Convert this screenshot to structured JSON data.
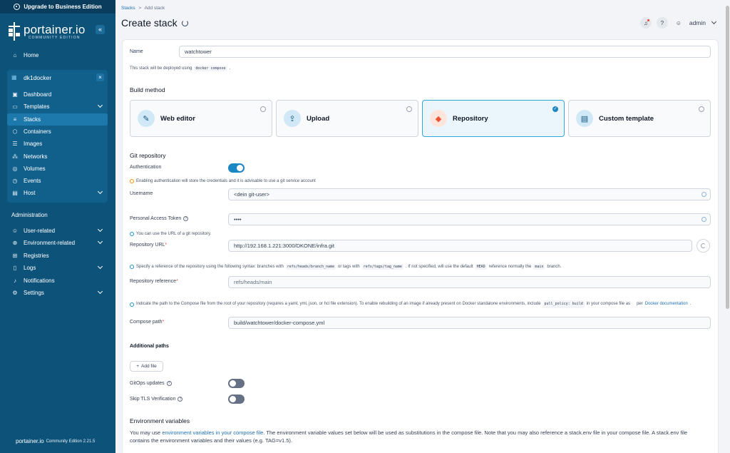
{
  "sidebar": {
    "upgrade_label": "Upgrade to Business Edition",
    "logo_text": "portainer.io",
    "logo_sub": "COMMUNITY EDITION",
    "collapse_icon": "«",
    "home": "Home",
    "environment": {
      "name": "dk1docker",
      "close": "×"
    },
    "env_items": [
      "Dashboard",
      "Templates",
      "Stacks",
      "Containers",
      "Images",
      "Networks",
      "Volumes",
      "Events",
      "Host"
    ],
    "administration_label": "Administration",
    "admin_items": [
      "User-related",
      "Environment-related",
      "Registries",
      "Logs",
      "Notifications",
      "Settings"
    ],
    "footer_brand": "portainer.io",
    "footer_text": "Community Edition 2.21.5"
  },
  "header": {
    "breadcrumb_root": "Stacks",
    "breadcrumb_sep": ">",
    "breadcrumb_current": "Add stack",
    "title": "Create stack",
    "user": "admin"
  },
  "form": {
    "name_label": "Name",
    "name_value": "watchtower",
    "deploy_note_prefix": "This stack will be deployed using",
    "deploy_note_code": "docker compose",
    "deploy_note_suffix": ".",
    "build_method_title": "Build method",
    "build_methods": [
      {
        "label": "Web editor",
        "icon": "edit-icon",
        "glyph": "✎"
      },
      {
        "label": "Upload",
        "icon": "upload-icon",
        "glyph": "⇪"
      },
      {
        "label": "Repository",
        "icon": "git-icon",
        "glyph": "◆"
      },
      {
        "label": "Custom template",
        "icon": "file-icon",
        "glyph": "▤"
      }
    ],
    "selected_check": "✓",
    "git_repository_title": "Git repository",
    "authentication_label": "Authentication",
    "auth_warning": "Enabling authentication will store the credentials and it is advisable to use a git service account",
    "username_label": "Username",
    "username_value": "<dein git-user>",
    "pat_label": "Personal Access Token",
    "pat_value": "••••",
    "url_help": "You can use the URL of a git repository.",
    "repo_url_label": "Repository URL",
    "repo_url_value": "http://192.168.1.221:3000/DKONE/infra.git",
    "ref_help_1": "Specify a reference of the repository using the following syntax: branches with",
    "ref_help_code1": "refs/heads/branch_name",
    "ref_help_2": "or tags with",
    "ref_help_code2": "refs/tags/tag_name",
    "ref_help_3": ". If not specified, will use the default",
    "ref_help_code3": "HEAD",
    "ref_help_4": "reference normally the",
    "ref_help_code4": "main",
    "ref_help_5": "branch.",
    "repo_ref_label": "Repository reference",
    "repo_ref_placeholder": "refs/heads/main",
    "path_help_1": "Indicate the path to the Compose file from the root of your repository (requires a yaml, yml, json, or hcl file extension).  To enable rebuilding of an image if already present on Docker standalone environments, include",
    "path_help_code": "pull_policy: build",
    "path_help_2": "in your compose file as",
    "path_help_3": "per",
    "path_help_link": "Docker documentation",
    "path_help_4": ".",
    "compose_path_label": "Compose path",
    "compose_path_value": "build/watchtower/docker-compose.yml",
    "additional_paths_title": "Additional paths",
    "add_file_label": "Add file",
    "gitops_label": "GitOps updates",
    "skip_tls_label": "Skip TLS Verification",
    "env_vars_title": "Environment variables",
    "env_text_1": "You may use",
    "env_text_link": "environment variables in your compose file",
    "env_text_2": ". The environment variable values set below will be used as substitutions in the compose file. Note that you may also reference a stack.env file in your compose file. A stack.env file contains the environment variables and their values (e.g. TAG=v1.5)."
  },
  "toggles": {
    "authentication": true,
    "gitops": false,
    "skip_tls": false
  },
  "colors": {
    "sidebar": "#0d5279",
    "accent": "#1b86c4",
    "required": "#f04438"
  }
}
